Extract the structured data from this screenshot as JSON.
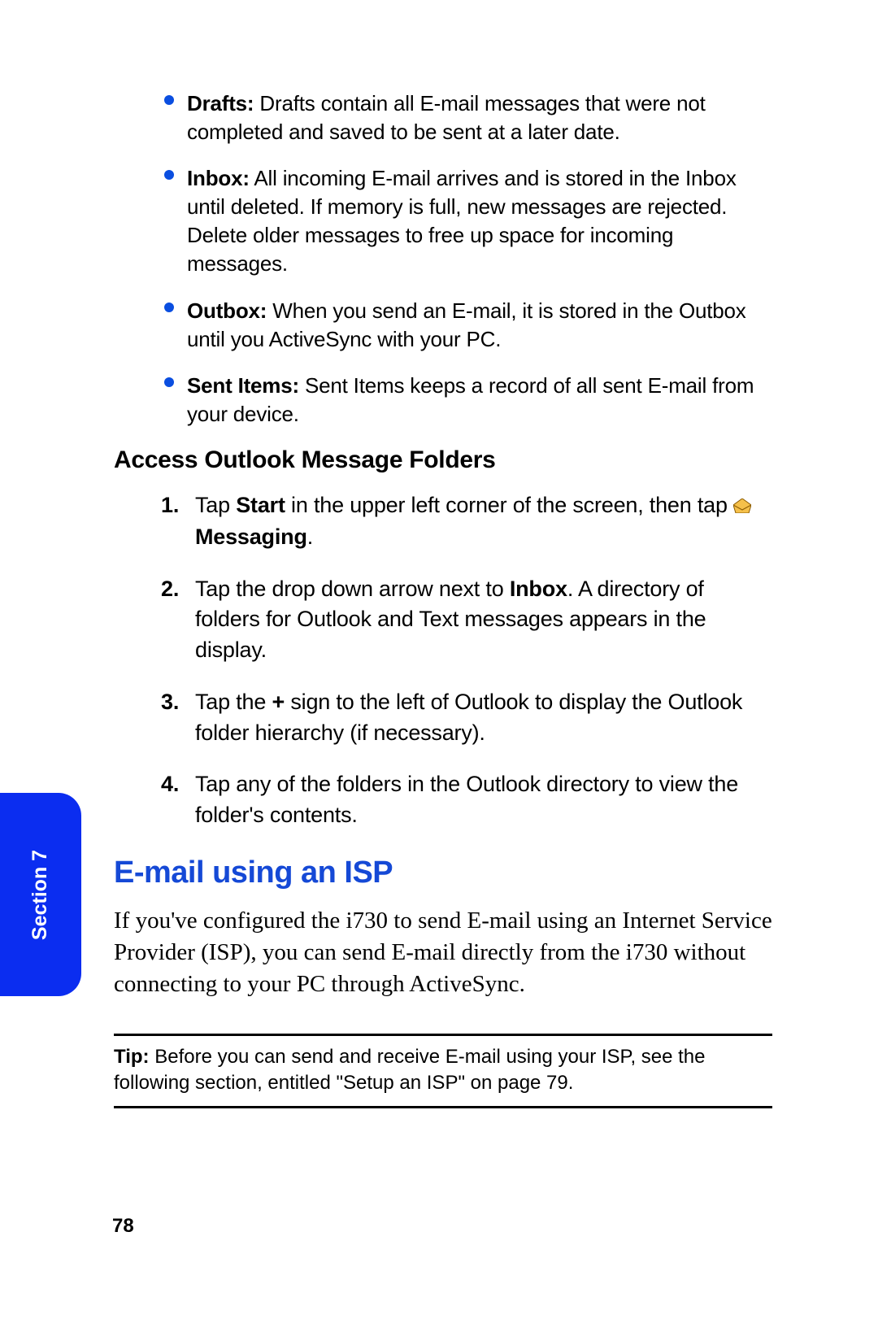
{
  "folders": [
    {
      "label": "Drafts:",
      "desc": " Drafts contain all E-mail messages that were not completed and saved to be sent at a later date."
    },
    {
      "label": "Inbox:",
      "desc": " All incoming E-mail arrives and is stored in the Inbox until deleted. If memory is full, new messages are rejected. Delete older messages to free up space for incoming messages."
    },
    {
      "label": "Outbox:",
      "desc": " When you send an E-mail, it is stored in the Outbox until you ActiveSync with your PC."
    },
    {
      "label": "Sent Items:",
      "desc": " Sent Items keeps a record of all sent E-mail from your device."
    }
  ],
  "subhead": "Access Outlook Message Folders",
  "steps": {
    "s1_num": "1.",
    "s1_a": "Tap ",
    "s1_start": "Start",
    "s1_b": " in the upper left corner of the screen, then tap ",
    "s1_messaging": " Messaging",
    "s1_c": ".",
    "s2_num": "2.",
    "s2_a": "Tap the drop down arrow next to ",
    "s2_inbox": "Inbox",
    "s2_b": ". A directory of folders for Outlook and Text messages appears in the display.",
    "s3_num": "3.",
    "s3_a": "Tap the ",
    "s3_plus": "+",
    "s3_b": " sign to the left of Outlook to display the Outlook folder hierarchy (if necessary).",
    "s4_num": "4.",
    "s4_a": "Tap any of the folders in the Outlook directory to view the folder's contents."
  },
  "section_title": "E-mail using an ISP",
  "body_para": "If you've configured the i730 to send E-mail using an Internet Service Provider (ISP), you can send E-mail directly from the i730 without connecting to your PC through ActiveSync.",
  "tip": {
    "label": "Tip: ",
    "text": "Before you can send and receive E-mail using your ISP, see the following section, entitled \"Setup an ISP\" on page 79."
  },
  "page_number": "78",
  "section_tab": "Section 7"
}
